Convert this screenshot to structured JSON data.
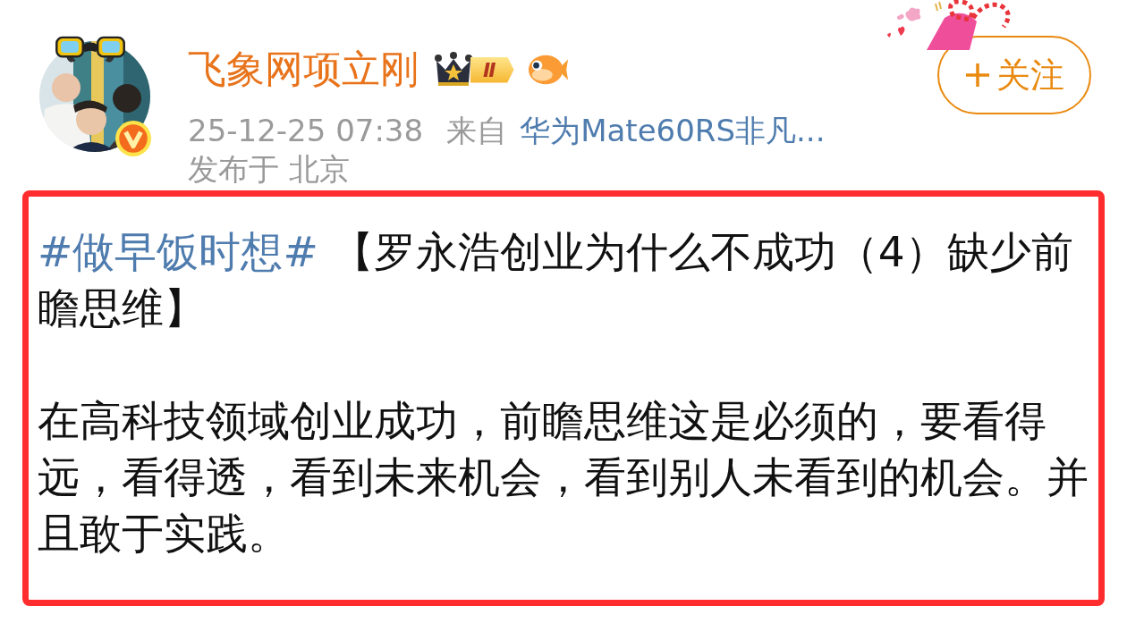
{
  "author": {
    "name": "飞象网项立刚",
    "level_badge": "Ⅱ",
    "verified": true
  },
  "meta": {
    "time": "25-12-25 07:38",
    "source_prefix": "来自",
    "source": "华为Mate60RS非凡...",
    "location": "发布于 北京"
  },
  "follow_button": {
    "label": "关注"
  },
  "post": {
    "hashtag": "#做早饭时想#",
    "title": "【罗永浩创业为什么不成功（4）缺少前瞻思维】",
    "paragraphs": [
      "在高科技领域创业成功，前瞻思维这是必须的，要看得远，看得透，看到未来机会，看到别人未看到的机会。并且敢于实践。"
    ]
  }
}
